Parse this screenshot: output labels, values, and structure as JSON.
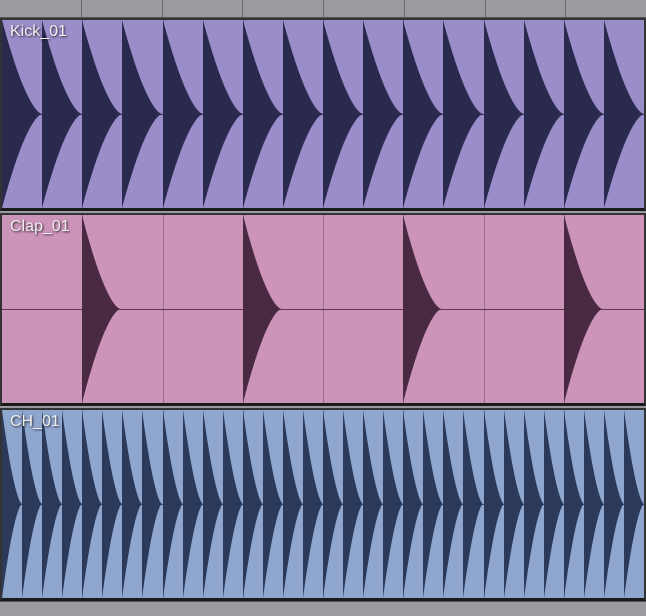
{
  "ruler": {
    "ticks_pct": [
      12.5,
      25,
      37.5,
      50,
      62.5,
      75,
      87.5
    ]
  },
  "tracks": [
    {
      "name": "Kick_01",
      "bg": "#9b8dc9",
      "wave": "#292a4d",
      "center": "#3a3a5a",
      "hits_pct": [
        0,
        6.25,
        12.5,
        18.75,
        25,
        31.25,
        37.5,
        43.75,
        50,
        56.25,
        62.5,
        68.75,
        75,
        81.25,
        87.5,
        93.75
      ],
      "hit_width_pct": 6.25,
      "shape_scale": 1.0
    },
    {
      "name": "Clap_01",
      "bg": "#cd94ba",
      "wave": "#4a2a42",
      "center": "#5a3a4e",
      "hits_pct": [
        12.5,
        37.5,
        62.5,
        87.5
      ],
      "hit_width_pct": 6.0,
      "shape_scale": 1.0
    },
    {
      "name": "CH_01",
      "bg": "#8fa7cf",
      "wave": "#2b3a5a",
      "center": "#3a4a6a",
      "hits_pct": [
        0,
        3.125,
        6.25,
        9.375,
        12.5,
        15.625,
        18.75,
        21.875,
        25,
        28.125,
        31.25,
        34.375,
        37.5,
        40.625,
        43.75,
        46.875,
        50,
        53.125,
        56.25,
        59.375,
        62.5,
        65.625,
        68.75,
        71.875,
        75,
        78.125,
        81.25,
        84.375,
        87.5,
        90.625,
        93.75,
        96.875
      ],
      "hit_width_pct": 3.125,
      "shape_scale": 1.0
    }
  ],
  "grid_pct": [
    12.5,
    25,
    37.5,
    50,
    62.5,
    75,
    87.5
  ]
}
